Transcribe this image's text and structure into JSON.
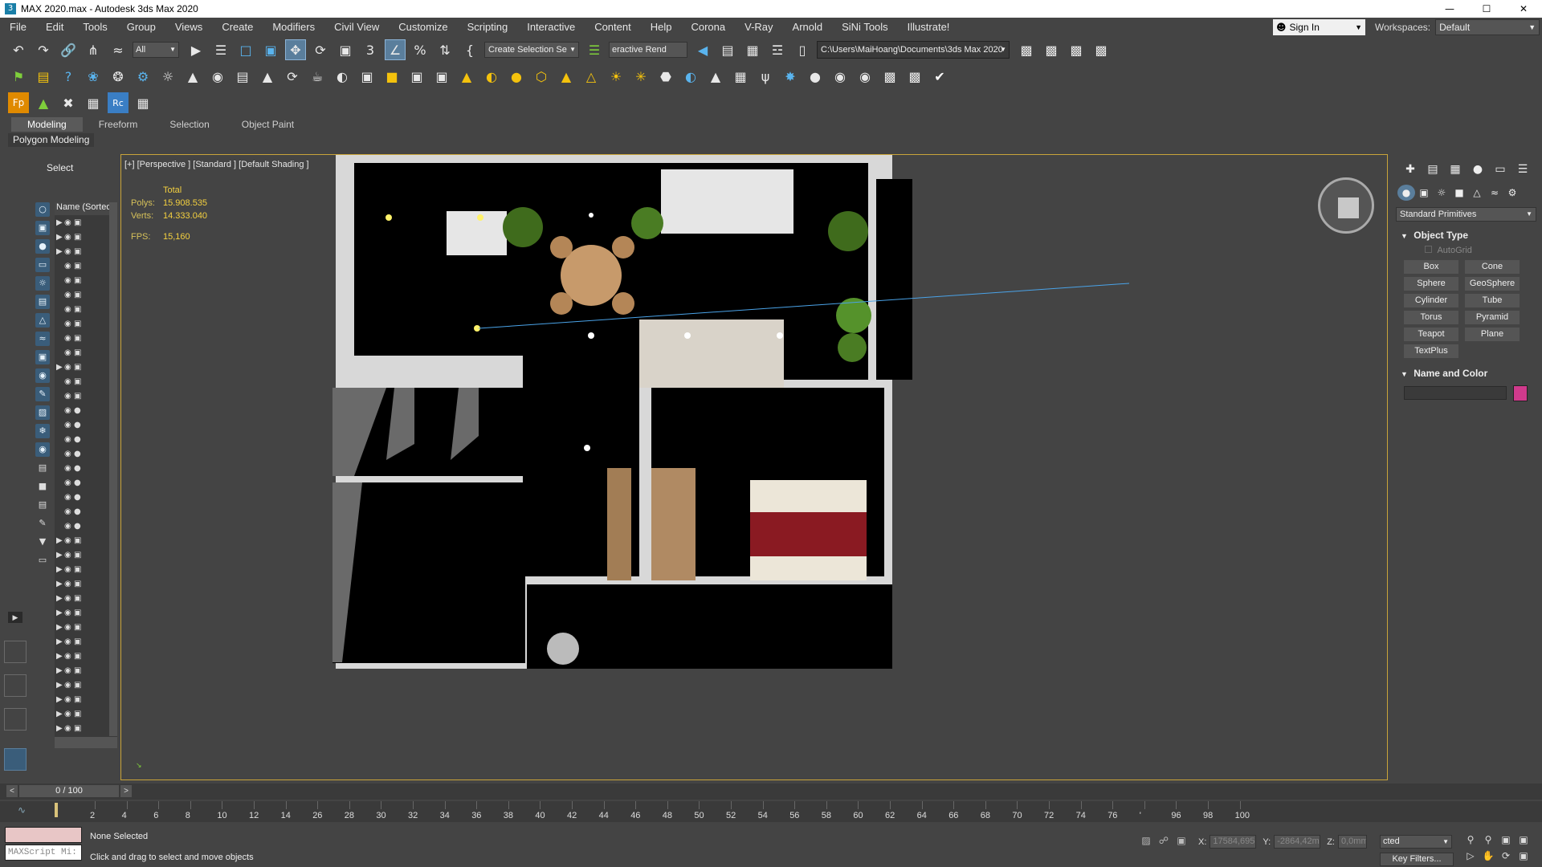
{
  "window": {
    "title": "MAX 2020.max - Autodesk 3ds Max 2020",
    "app_icon": "3",
    "controls": [
      "minimize-icon",
      "maximize-icon",
      "close-icon"
    ],
    "control_glyphs": [
      "—",
      "☐",
      "✕"
    ]
  },
  "menu": [
    "File",
    "Edit",
    "Tools",
    "Group",
    "Views",
    "Create",
    "Modifiers",
    "Civil View",
    "Customize",
    "Scripting",
    "Interactive",
    "Content",
    "Help",
    "Corona",
    "V-Ray",
    "Arnold",
    "SiNi Tools",
    "Illustrate!"
  ],
  "signin": {
    "label": "Sign In"
  },
  "workspaces": {
    "label": "Workspaces:",
    "value": "Default"
  },
  "toolbar": {
    "selection_filter": "All",
    "create_selection_set": "Create Selection Se",
    "render_field": "eractive Rend",
    "project_path": "C:\\Users\\MaiHoang\\Documents\\3ds Max 2020"
  },
  "ribbon": {
    "tabs": [
      "Modeling",
      "Freeform",
      "Selection",
      "Object Paint"
    ],
    "active_tab": "Modeling",
    "sub_label": "Polygon Modeling"
  },
  "scene_explorer": {
    "header": "Select",
    "column_header": "Name (Sorted A",
    "row_count": 36
  },
  "viewport": {
    "label": "[+] [Perspective ] [Standard ] [Default Shading ]",
    "stats": {
      "total_label": "Total",
      "polys_label": "Polys:",
      "polys_value": "15.908.535",
      "verts_label": "Verts:",
      "verts_value": "14.333.040",
      "fps_label": "FPS:",
      "fps_value": "15,160"
    }
  },
  "command_panel": {
    "category": "Standard Primitives",
    "object_type_title": "Object Type",
    "autogrid_label": "AutoGrid",
    "primitives": [
      "Box",
      "Cone",
      "Sphere",
      "GeoSphere",
      "Cylinder",
      "Tube",
      "Torus",
      "Pyramid",
      "Teapot",
      "Plane",
      "TextPlus"
    ],
    "name_color_title": "Name and Color",
    "color": "#d03a8c"
  },
  "timeslider": {
    "frame": "0 / 100"
  },
  "trackbar": {
    "ticks": [
      "2",
      "4",
      "6",
      "8",
      "10",
      "12",
      "14",
      "26",
      "28",
      "30",
      "32",
      "34",
      "36",
      "38",
      "40",
      "42",
      "44",
      "46",
      "48",
      "50",
      "52",
      "54",
      "56",
      "58",
      "60",
      "62",
      "64",
      "66",
      "68",
      "70",
      "72",
      "74",
      "76",
      "'",
      "96",
      "98",
      "100"
    ]
  },
  "status": {
    "selection": "None Selected",
    "prompt": "Click and drag to select and move objects",
    "maxscript_placeholder": "MAXScript Mi:",
    "x_label": "X:",
    "x_value": "17584,695",
    "y_label": "Y:",
    "y_value": "-2864,42m",
    "z_label": "Z:",
    "z_value": "0,0mm",
    "selection_set": "cted",
    "key_filters": "Key Filters..."
  },
  "colors": {
    "viewport_border": "#c9a43a",
    "active_tool": "#5a7e9c",
    "stats_text": "#f4d03f"
  }
}
